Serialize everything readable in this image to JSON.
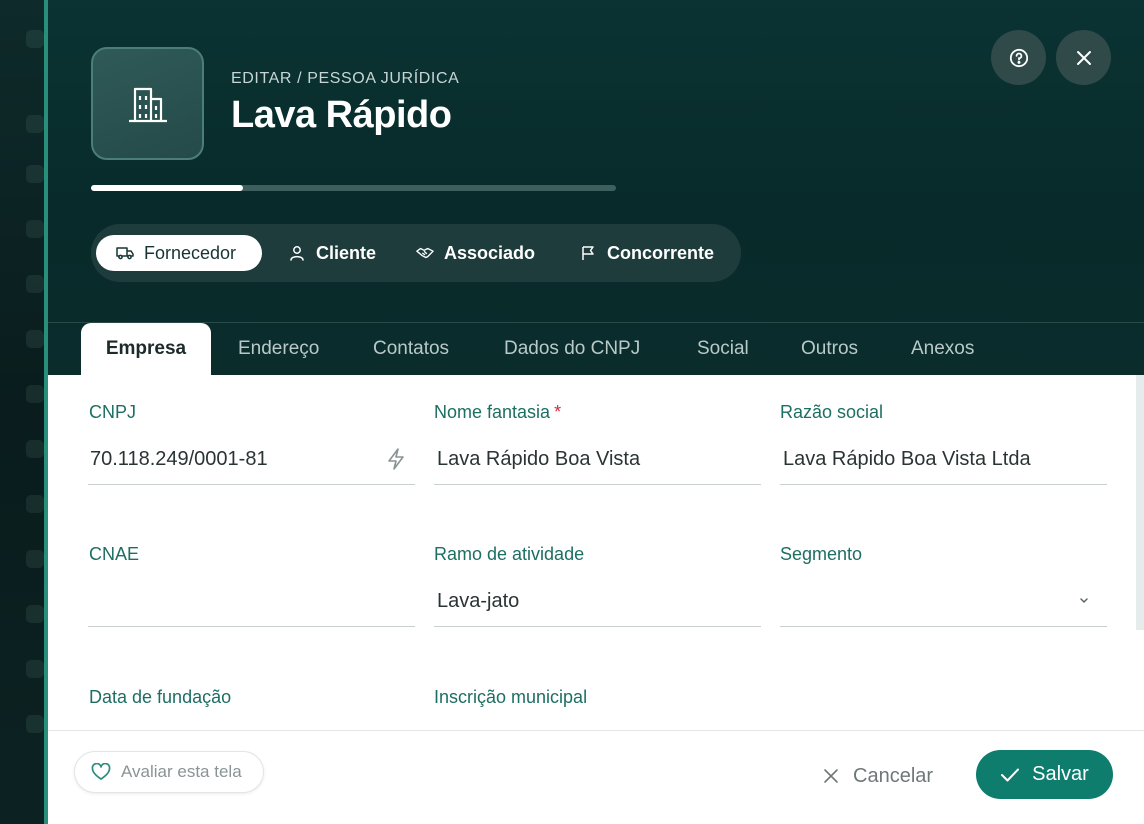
{
  "header": {
    "breadcrumb": "EDITAR / PESSOA JURÍDICA",
    "title": "Lava Rápido",
    "avatar_icon": "building-icon",
    "progress": 0.29
  },
  "actions": {
    "help_icon": "help-circle-icon",
    "close_icon": "close-icon"
  },
  "roles": [
    {
      "label": "Fornecedor",
      "icon": "truck-icon",
      "active": true
    },
    {
      "label": "Cliente",
      "icon": "user-icon",
      "active": false
    },
    {
      "label": "Associado",
      "icon": "handshake-icon",
      "active": false
    },
    {
      "label": "Concorrente",
      "icon": "flag-icon",
      "active": false
    }
  ],
  "tabs": [
    {
      "label": "Empresa",
      "active": true
    },
    {
      "label": "Endereço",
      "active": false
    },
    {
      "label": "Contatos",
      "active": false
    },
    {
      "label": "Dados do CNPJ",
      "active": false
    },
    {
      "label": "Social",
      "active": false
    },
    {
      "label": "Outros",
      "active": false
    },
    {
      "label": "Anexos",
      "active": false
    }
  ],
  "form": {
    "cnpj": {
      "label": "CNPJ",
      "value": "70.118.249/0001-81"
    },
    "nome_fantasia": {
      "label": "Nome fantasia",
      "required_mark": "*",
      "value": "Lava Rápido Boa Vista"
    },
    "razao_social": {
      "label": "Razão social",
      "value": "Lava Rápido Boa Vista Ltda"
    },
    "cnae": {
      "label": "CNAE",
      "value": ""
    },
    "ramo_atividade": {
      "label": "Ramo de atividade",
      "value": "Lava-jato"
    },
    "segmento": {
      "label": "Segmento",
      "value": ""
    },
    "data_fundacao": {
      "label": "Data de fundação"
    },
    "inscricao_municipal": {
      "label": "Inscrição municipal"
    }
  },
  "footer": {
    "rate_label": "Avaliar esta tela",
    "cancel_label": "Cancelar",
    "save_label": "Salvar"
  },
  "colors": {
    "accent": "#0f7d6d",
    "header_bg": "#0b3333",
    "label": "#1d6e63",
    "required": "#d7263d"
  }
}
